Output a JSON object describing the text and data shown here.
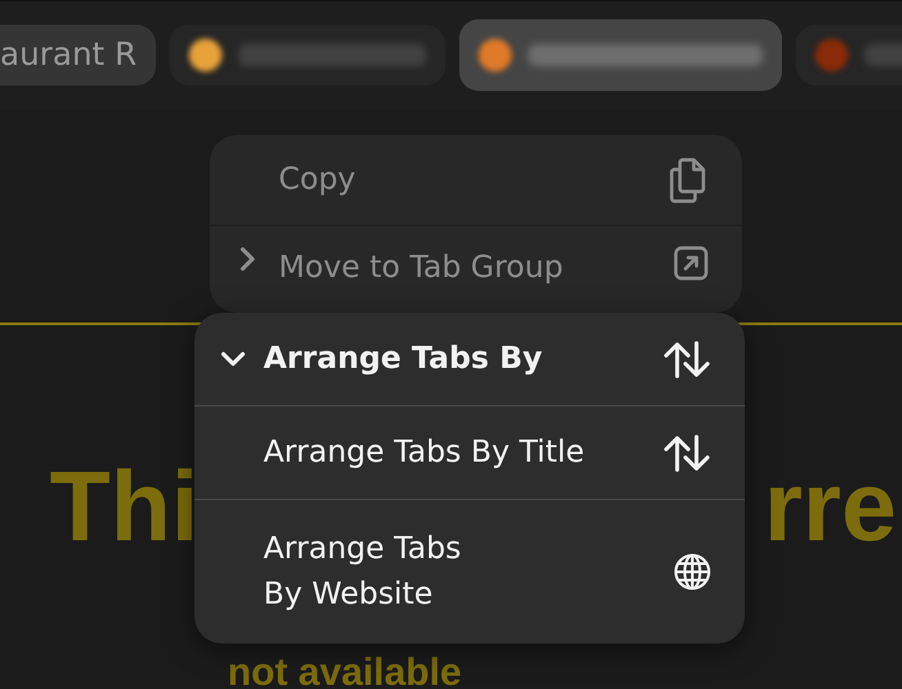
{
  "tabs": [
    {
      "kind": "text",
      "label": "aurant R",
      "selected": false
    },
    {
      "kind": "blurred",
      "color": "#e8a23a",
      "selected": false
    },
    {
      "kind": "blurred",
      "color": "#e07a28",
      "selected": true
    },
    {
      "kind": "blurred",
      "color": "#8a2a08",
      "selected": false
    }
  ],
  "page": {
    "heading_left": "Thi",
    "heading_right": "rre",
    "second_line": "not available"
  },
  "back_menu": {
    "items": [
      {
        "kind": "action",
        "label": "Copy"
      },
      {
        "kind": "submenu",
        "label": "Move to Tab Group",
        "expanded": false
      }
    ]
  },
  "front_menu": {
    "header": {
      "kind": "submenu",
      "label": "Arrange Tabs By",
      "expanded": true
    },
    "items": [
      {
        "kind": "action",
        "label": "Arrange Tabs By Title"
      },
      {
        "kind": "action",
        "label": "Arrange Tabs\nBy Website"
      }
    ]
  }
}
